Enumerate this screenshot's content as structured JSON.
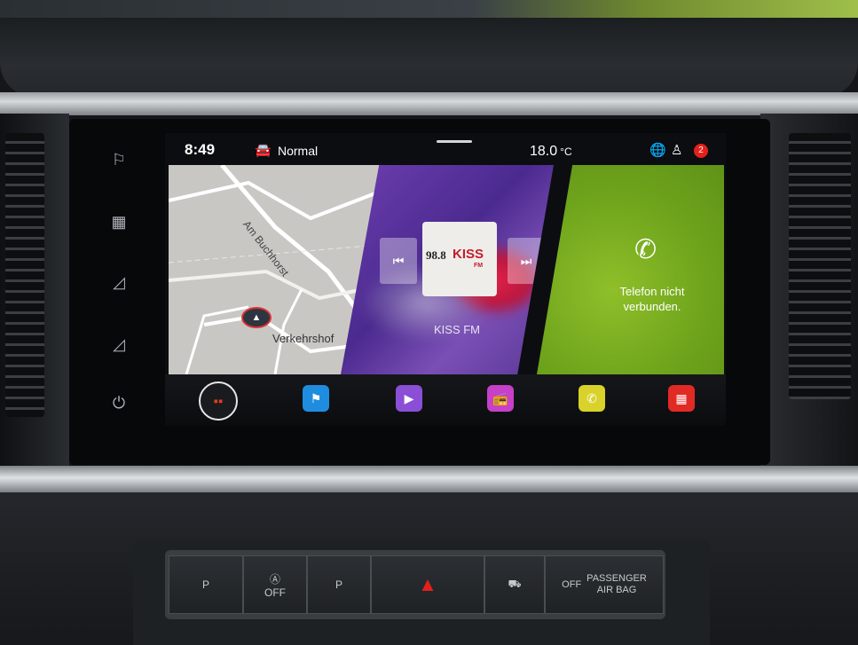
{
  "status_bar": {
    "time": "8:49",
    "drive_mode": "Normal",
    "temperature": "18.0",
    "temperature_unit": "°C",
    "notification_count": "2"
  },
  "map_tile": {
    "street_labels": [
      "Am Buchhorst",
      "Verkehrshof"
    ]
  },
  "radio_tile": {
    "logo_frequency": "98.8",
    "logo_brand": "KISS",
    "logo_fm": "FM",
    "station_name": "KISS FM"
  },
  "phone_tile": {
    "line1": "Telefon nicht",
    "line2": "verbunden."
  },
  "hardware_buttons": {
    "auto_hold_off": "OFF",
    "passenger_airbag_line1": "PASSENGER",
    "passenger_airbag_line2": "AIR BAG",
    "airbag_off": "OFF",
    "park_assist": "P",
    "park_sensor": "P"
  },
  "colors": {
    "nav": "#1e8de0",
    "media": "#8a4fd6",
    "radio": "#c640c8",
    "phone": "#d8d22a",
    "car": "#e22a24",
    "phone_tile": "#7cb224",
    "badge": "#e2211c"
  },
  "icons": {
    "sidebar": [
      "flag-icon",
      "keyboard-icon",
      "volume-up-icon",
      "volume-down-icon",
      "power-icon"
    ],
    "dock": [
      "home-grid-icon",
      "navigation-flag-icon",
      "media-play-icon",
      "radio-icon",
      "phone-icon",
      "car-settings-icon"
    ]
  }
}
